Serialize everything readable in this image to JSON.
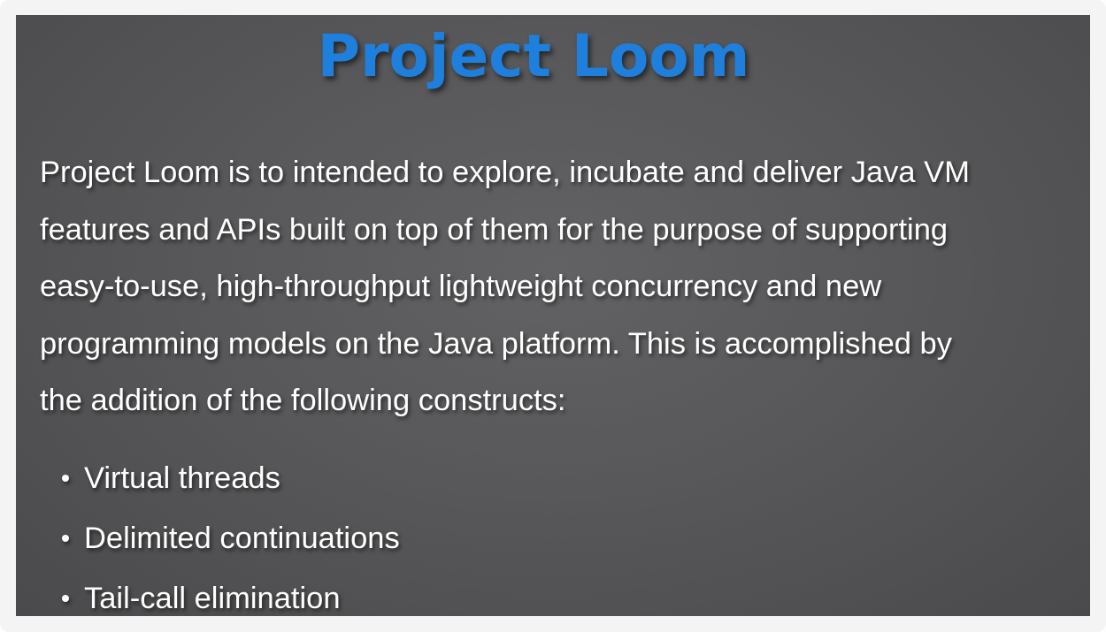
{
  "slide": {
    "title": "Project Loom",
    "title_color": "#1e80dc",
    "background_color": "#58585a",
    "paragraph_lines": [
      "Project Loom is to intended to explore, incubate and deliver Java VM",
      "features and APIs built on top of them for the purpose of supporting",
      "easy-to-use, high-throughput lightweight concurrency and new",
      "programming models on the Java platform. This is accomplished by",
      "the addition of the following constructs:"
    ],
    "bullets": [
      "Virtual threads",
      "Delimited continuations",
      "Tail-call elimination"
    ]
  }
}
